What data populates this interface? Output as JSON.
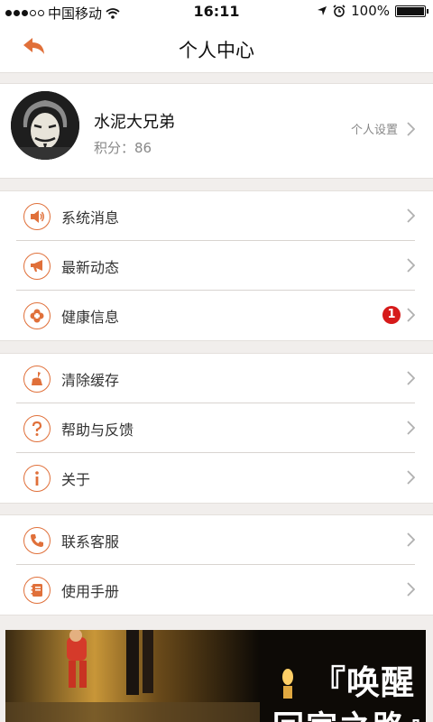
{
  "status_bar": {
    "carrier": "中国移动",
    "time": "16:11",
    "battery": "100%"
  },
  "header": {
    "title": "个人中心"
  },
  "profile": {
    "name": "水泥大兄弟",
    "points": "积分：86",
    "settings_label": "个人设置"
  },
  "groups": [
    [
      {
        "label": "系统消息",
        "icon": "speaker-icon"
      },
      {
        "label": "最新动态",
        "icon": "megaphone-icon"
      },
      {
        "label": "健康信息",
        "icon": "health-cross-icon",
        "badge": "1"
      }
    ],
    [
      {
        "label": "清除缓存",
        "icon": "broom-icon"
      },
      {
        "label": "帮助与反馈",
        "icon": "question-icon"
      },
      {
        "label": "关于",
        "icon": "info-icon"
      }
    ],
    [
      {
        "label": "联系客服",
        "icon": "phone-icon"
      },
      {
        "label": "使用手册",
        "icon": "manual-icon"
      }
    ]
  ],
  "banner": {
    "line1": "『唤醒",
    "line2": "回家之路』"
  },
  "colors": {
    "accent": "#e0703a",
    "badge": "#d61a1a",
    "background": "#f1eeec"
  }
}
